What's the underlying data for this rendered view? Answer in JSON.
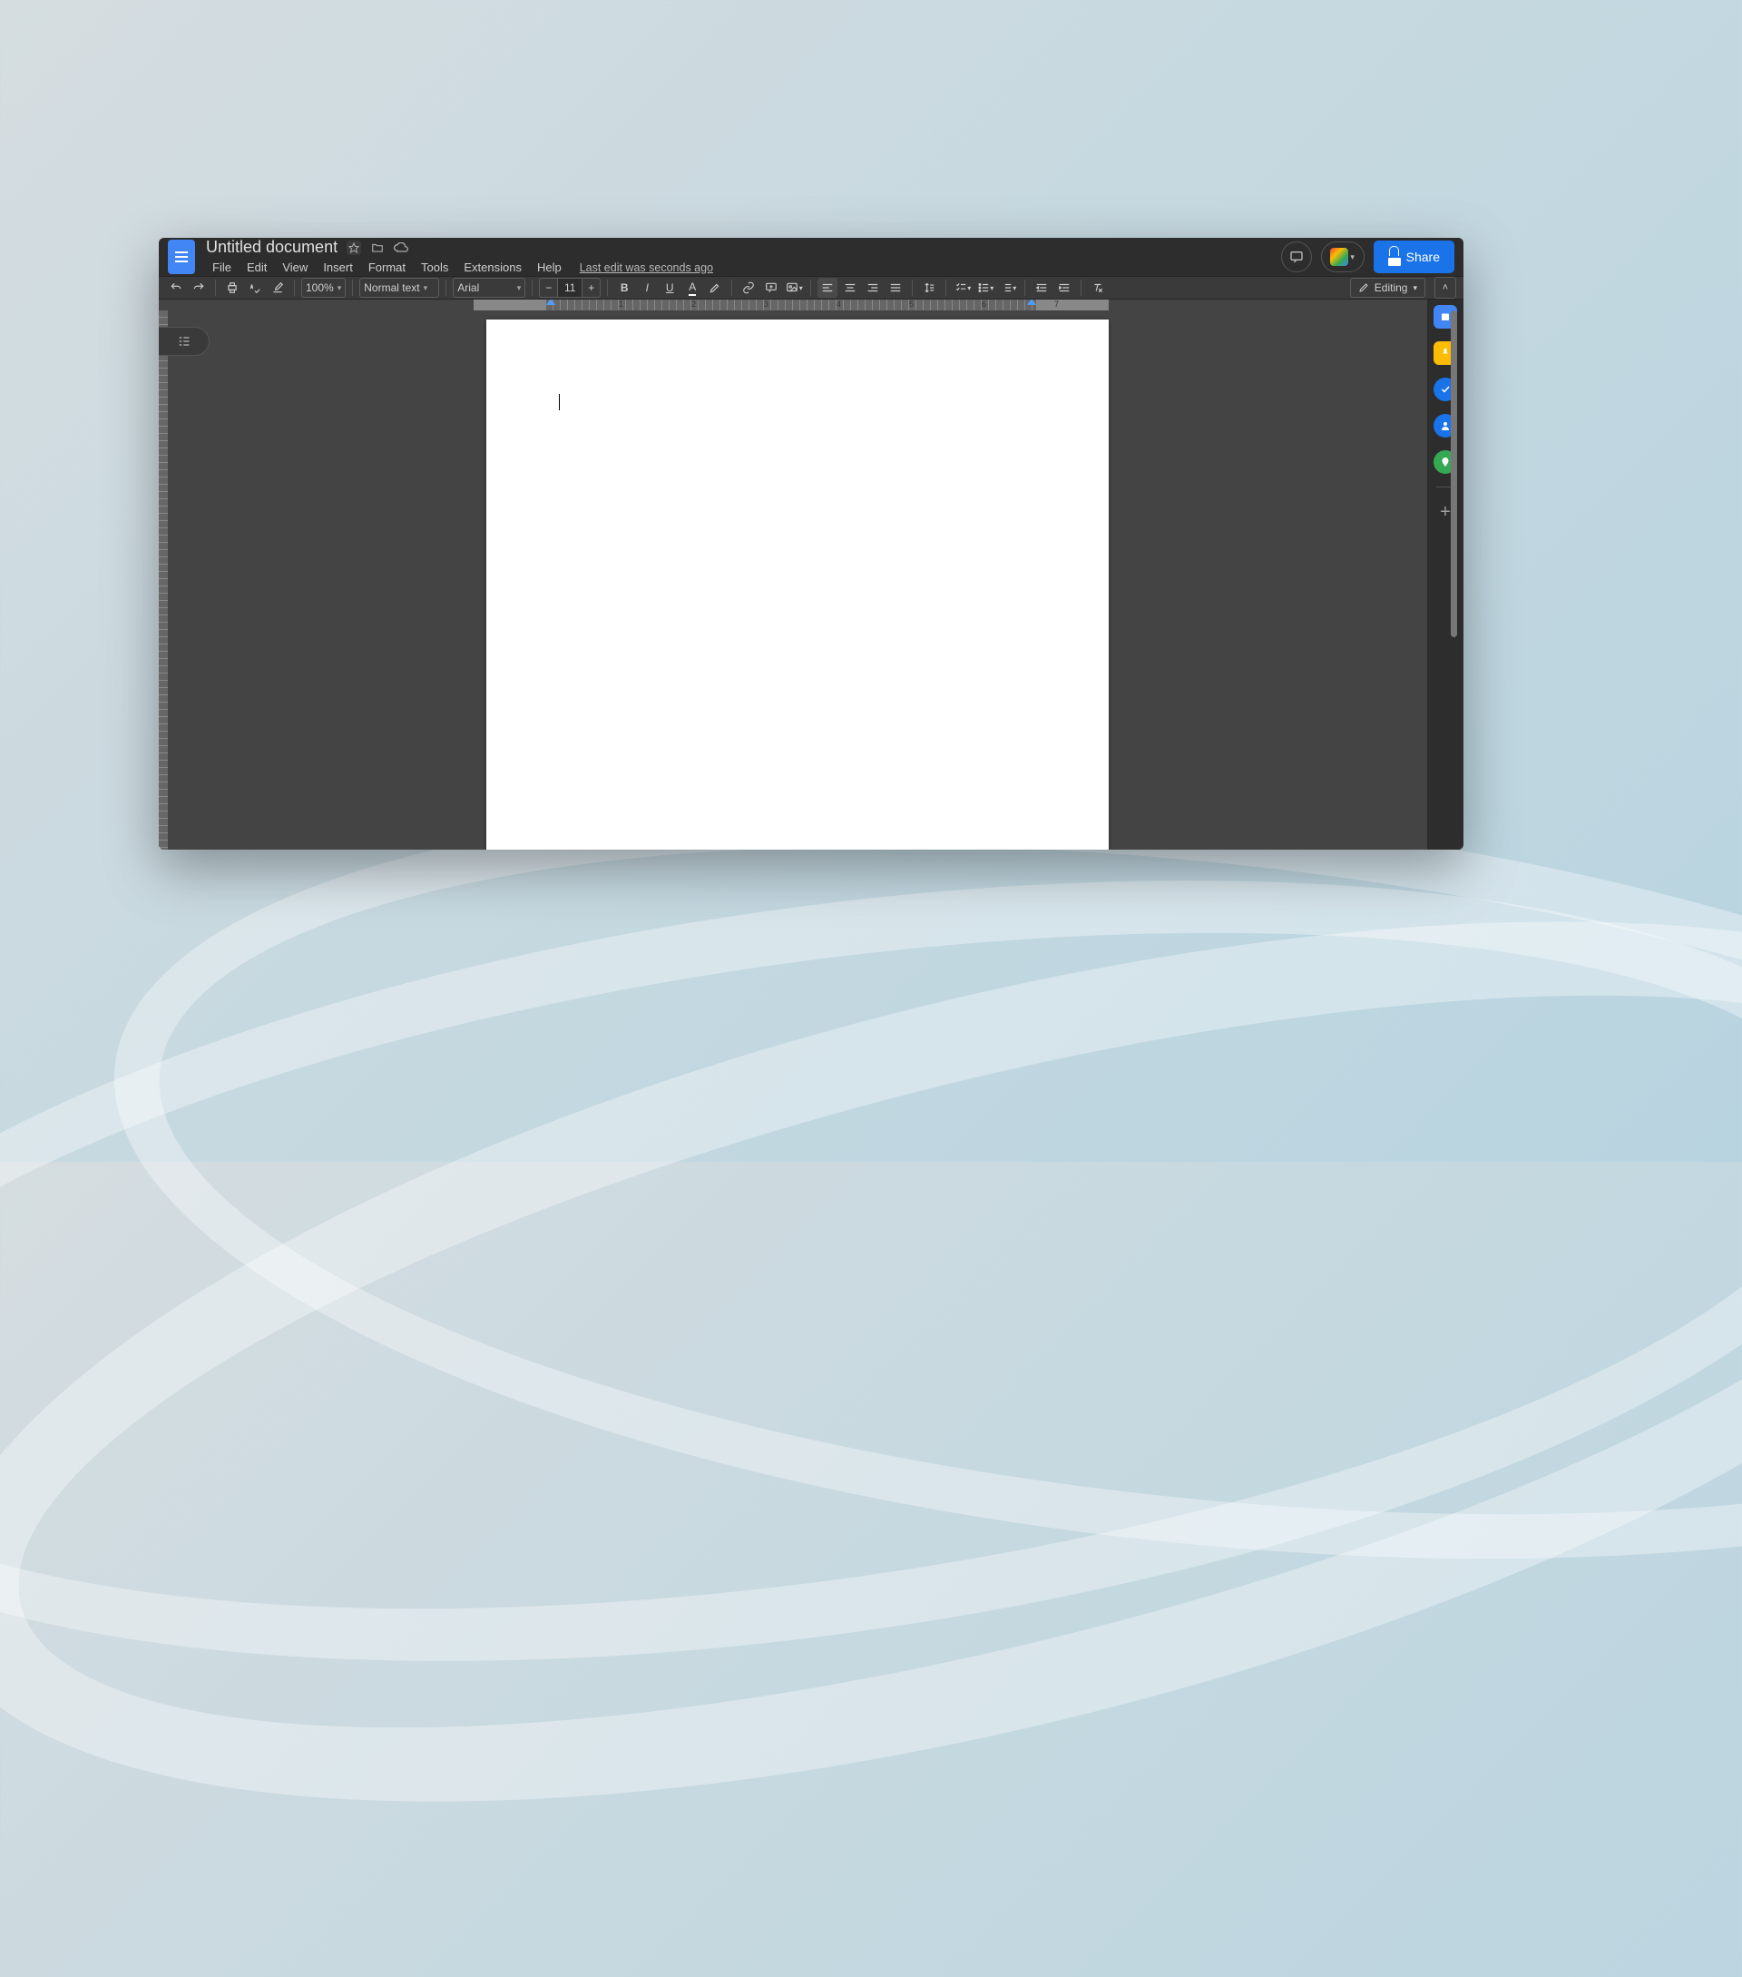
{
  "header": {
    "doc_title": "Untitled document",
    "last_edit": "Last edit was seconds ago",
    "share_label": "Share"
  },
  "menu": [
    "File",
    "Edit",
    "View",
    "Insert",
    "Format",
    "Tools",
    "Extensions",
    "Help"
  ],
  "toolbar": {
    "zoom": "100%",
    "style": "Normal text",
    "font": "Arial",
    "font_size": "11",
    "mode": "Editing"
  },
  "ruler": {
    "numbers": [
      "1",
      "2",
      "3",
      "4",
      "5",
      "6",
      "7"
    ]
  },
  "document": {
    "content": ""
  }
}
